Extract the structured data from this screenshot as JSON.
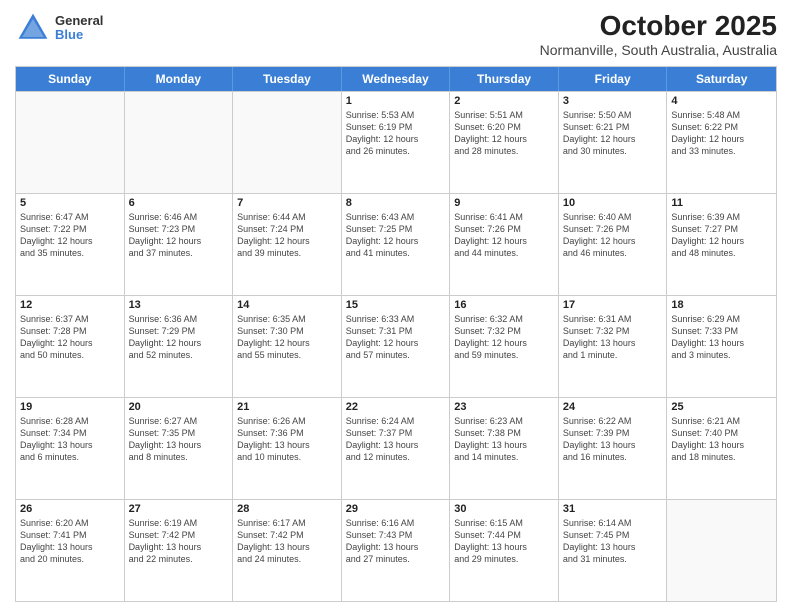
{
  "header": {
    "logo_general": "General",
    "logo_blue": "Blue",
    "title": "October 2025",
    "subtitle": "Normanville, South Australia, Australia"
  },
  "days_of_week": [
    "Sunday",
    "Monday",
    "Tuesday",
    "Wednesday",
    "Thursday",
    "Friday",
    "Saturday"
  ],
  "weeks": [
    [
      {
        "day": "",
        "info": ""
      },
      {
        "day": "",
        "info": ""
      },
      {
        "day": "",
        "info": ""
      },
      {
        "day": "1",
        "info": "Sunrise: 5:53 AM\nSunset: 6:19 PM\nDaylight: 12 hours\nand 26 minutes."
      },
      {
        "day": "2",
        "info": "Sunrise: 5:51 AM\nSunset: 6:20 PM\nDaylight: 12 hours\nand 28 minutes."
      },
      {
        "day": "3",
        "info": "Sunrise: 5:50 AM\nSunset: 6:21 PM\nDaylight: 12 hours\nand 30 minutes."
      },
      {
        "day": "4",
        "info": "Sunrise: 5:48 AM\nSunset: 6:22 PM\nDaylight: 12 hours\nand 33 minutes."
      }
    ],
    [
      {
        "day": "5",
        "info": "Sunrise: 6:47 AM\nSunset: 7:22 PM\nDaylight: 12 hours\nand 35 minutes."
      },
      {
        "day": "6",
        "info": "Sunrise: 6:46 AM\nSunset: 7:23 PM\nDaylight: 12 hours\nand 37 minutes."
      },
      {
        "day": "7",
        "info": "Sunrise: 6:44 AM\nSunset: 7:24 PM\nDaylight: 12 hours\nand 39 minutes."
      },
      {
        "day": "8",
        "info": "Sunrise: 6:43 AM\nSunset: 7:25 PM\nDaylight: 12 hours\nand 41 minutes."
      },
      {
        "day": "9",
        "info": "Sunrise: 6:41 AM\nSunset: 7:26 PM\nDaylight: 12 hours\nand 44 minutes."
      },
      {
        "day": "10",
        "info": "Sunrise: 6:40 AM\nSunset: 7:26 PM\nDaylight: 12 hours\nand 46 minutes."
      },
      {
        "day": "11",
        "info": "Sunrise: 6:39 AM\nSunset: 7:27 PM\nDaylight: 12 hours\nand 48 minutes."
      }
    ],
    [
      {
        "day": "12",
        "info": "Sunrise: 6:37 AM\nSunset: 7:28 PM\nDaylight: 12 hours\nand 50 minutes."
      },
      {
        "day": "13",
        "info": "Sunrise: 6:36 AM\nSunset: 7:29 PM\nDaylight: 12 hours\nand 52 minutes."
      },
      {
        "day": "14",
        "info": "Sunrise: 6:35 AM\nSunset: 7:30 PM\nDaylight: 12 hours\nand 55 minutes."
      },
      {
        "day": "15",
        "info": "Sunrise: 6:33 AM\nSunset: 7:31 PM\nDaylight: 12 hours\nand 57 minutes."
      },
      {
        "day": "16",
        "info": "Sunrise: 6:32 AM\nSunset: 7:32 PM\nDaylight: 12 hours\nand 59 minutes."
      },
      {
        "day": "17",
        "info": "Sunrise: 6:31 AM\nSunset: 7:32 PM\nDaylight: 13 hours\nand 1 minute."
      },
      {
        "day": "18",
        "info": "Sunrise: 6:29 AM\nSunset: 7:33 PM\nDaylight: 13 hours\nand 3 minutes."
      }
    ],
    [
      {
        "day": "19",
        "info": "Sunrise: 6:28 AM\nSunset: 7:34 PM\nDaylight: 13 hours\nand 6 minutes."
      },
      {
        "day": "20",
        "info": "Sunrise: 6:27 AM\nSunset: 7:35 PM\nDaylight: 13 hours\nand 8 minutes."
      },
      {
        "day": "21",
        "info": "Sunrise: 6:26 AM\nSunset: 7:36 PM\nDaylight: 13 hours\nand 10 minutes."
      },
      {
        "day": "22",
        "info": "Sunrise: 6:24 AM\nSunset: 7:37 PM\nDaylight: 13 hours\nand 12 minutes."
      },
      {
        "day": "23",
        "info": "Sunrise: 6:23 AM\nSunset: 7:38 PM\nDaylight: 13 hours\nand 14 minutes."
      },
      {
        "day": "24",
        "info": "Sunrise: 6:22 AM\nSunset: 7:39 PM\nDaylight: 13 hours\nand 16 minutes."
      },
      {
        "day": "25",
        "info": "Sunrise: 6:21 AM\nSunset: 7:40 PM\nDaylight: 13 hours\nand 18 minutes."
      }
    ],
    [
      {
        "day": "26",
        "info": "Sunrise: 6:20 AM\nSunset: 7:41 PM\nDaylight: 13 hours\nand 20 minutes."
      },
      {
        "day": "27",
        "info": "Sunrise: 6:19 AM\nSunset: 7:42 PM\nDaylight: 13 hours\nand 22 minutes."
      },
      {
        "day": "28",
        "info": "Sunrise: 6:17 AM\nSunset: 7:42 PM\nDaylight: 13 hours\nand 24 minutes."
      },
      {
        "day": "29",
        "info": "Sunrise: 6:16 AM\nSunset: 7:43 PM\nDaylight: 13 hours\nand 27 minutes."
      },
      {
        "day": "30",
        "info": "Sunrise: 6:15 AM\nSunset: 7:44 PM\nDaylight: 13 hours\nand 29 minutes."
      },
      {
        "day": "31",
        "info": "Sunrise: 6:14 AM\nSunset: 7:45 PM\nDaylight: 13 hours\nand 31 minutes."
      },
      {
        "day": "",
        "info": ""
      }
    ]
  ]
}
